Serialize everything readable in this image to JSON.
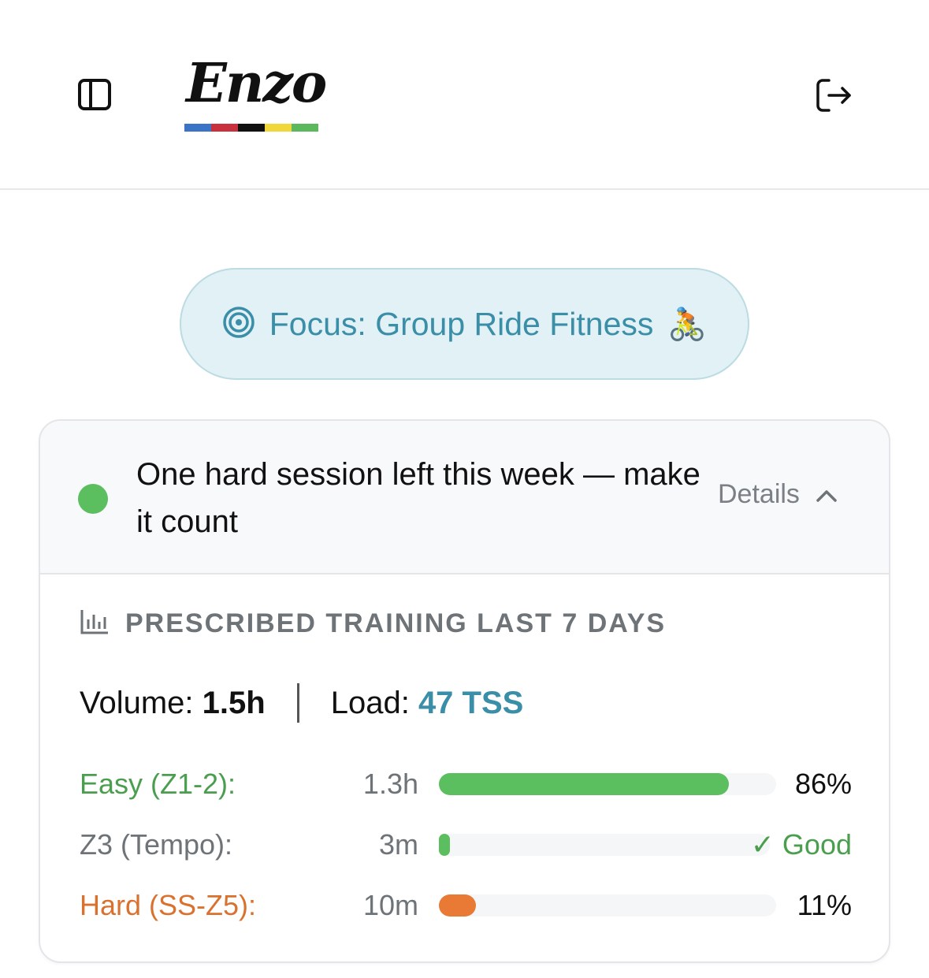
{
  "header": {
    "logo_text": "Enzo",
    "logo_stripe_colors": [
      "#3b73c6",
      "#c8303e",
      "#111111",
      "#f0d83a",
      "#5cb85c"
    ]
  },
  "focus": {
    "label": "Focus: Group Ride Fitness",
    "emoji": "🚴"
  },
  "card": {
    "status_color": "#5bbf5f",
    "message": "One hard session left this week — make it count",
    "details_label": "Details",
    "section_title": "PRESCRIBED TRAINING LAST 7 DAYS",
    "volume_label": "Volume:",
    "volume_value": "1.5h",
    "load_label": "Load:",
    "load_value": "47 TSS",
    "zones": [
      {
        "label": "Easy (Z1-2):",
        "duration": "1.3h",
        "fraction": 0.86,
        "status": "86%",
        "color": "#5bbf5f",
        "label_color": "#4a9e4e",
        "status_color": "#111111"
      },
      {
        "label": "Z3 (Tempo):",
        "duration": "3m",
        "fraction": 0.03,
        "status": "✓ Good",
        "color": "#5bbf5f",
        "label_color": "#6e7378",
        "status_color": "#4a9e4e"
      },
      {
        "label": "Hard (SS-Z5):",
        "duration": "10m",
        "fraction": 0.11,
        "status": "11%",
        "color": "#e87a35",
        "label_color": "#d9712f",
        "status_color": "#111111"
      }
    ]
  }
}
